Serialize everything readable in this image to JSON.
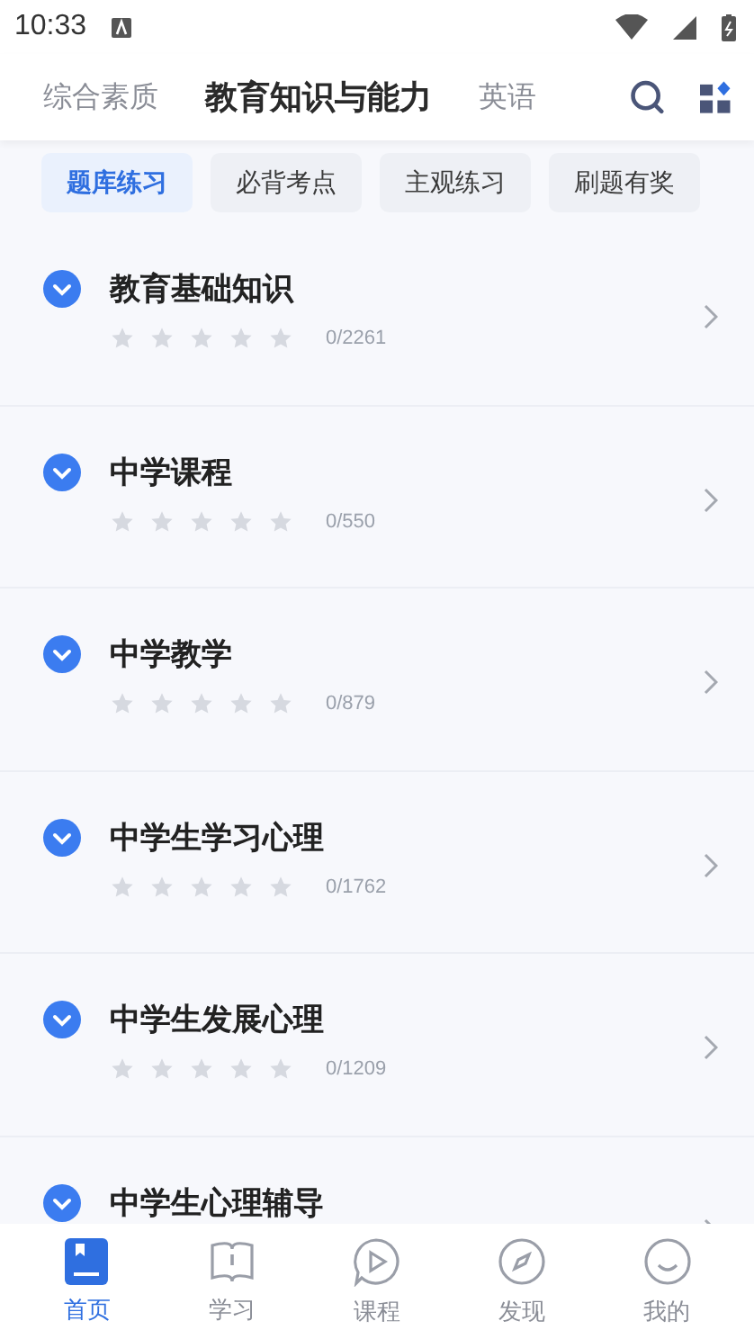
{
  "status_bar": {
    "time": "10:33"
  },
  "subject_tabs": [
    {
      "label": "综合素质",
      "selected": false
    },
    {
      "label": "教育知识与能力",
      "selected": true
    },
    {
      "label": "英语",
      "selected": false
    }
  ],
  "chips": [
    {
      "label": "题库练习",
      "selected": true
    },
    {
      "label": "必背考点",
      "selected": false
    },
    {
      "label": "主观练习",
      "selected": false
    },
    {
      "label": "刷题有奖",
      "selected": false
    }
  ],
  "chapters": [
    {
      "title": "教育基础知识",
      "stars": 0,
      "progress": "0/2261"
    },
    {
      "title": "中学课程",
      "stars": 0,
      "progress": "0/550"
    },
    {
      "title": "中学教学",
      "stars": 0,
      "progress": "0/879"
    },
    {
      "title": "中学生学习心理",
      "stars": 0,
      "progress": "0/1762"
    },
    {
      "title": "中学生发展心理",
      "stars": 0,
      "progress": "0/1209"
    },
    {
      "title": "中学生心理辅导"
    }
  ],
  "bottom_nav": [
    {
      "label": "首页",
      "selected": true
    },
    {
      "label": "学习",
      "selected": false
    },
    {
      "label": "课程",
      "selected": false
    },
    {
      "label": "发现",
      "selected": false
    },
    {
      "label": "我的",
      "selected": false
    }
  ]
}
